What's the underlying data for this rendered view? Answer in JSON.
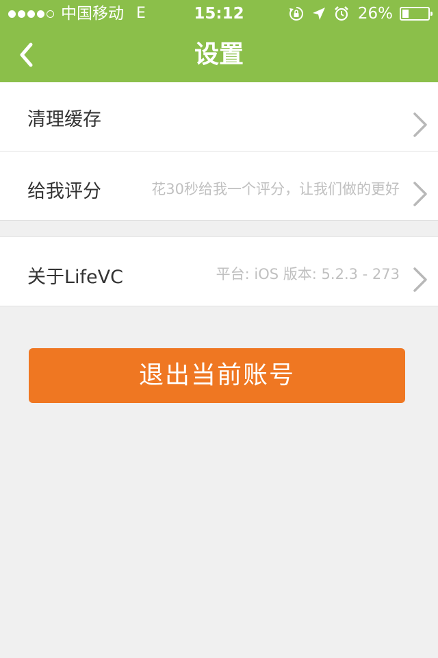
{
  "status_bar": {
    "carrier": "中国移动",
    "network": "E",
    "time": "15:12",
    "battery_percent_label": "26%",
    "battery_level": 0.26,
    "signal_bars_filled": 4,
    "signal_bars_total": 5
  },
  "nav": {
    "title": "设置"
  },
  "settings": {
    "clear_cache": {
      "title": "清理缓存"
    },
    "rate": {
      "title": "给我评分",
      "detail": "花30秒给我一个评分，让我们做的更好"
    },
    "about": {
      "title": "关于LifeVC",
      "detail": "平台: iOS 版本:  5.2.3 - 273"
    }
  },
  "logout": {
    "label": "退出当前账号"
  },
  "colors": {
    "nav_green": "#8bbf4a",
    "logout_orange": "#ef7722",
    "background": "#f0f0f0"
  }
}
